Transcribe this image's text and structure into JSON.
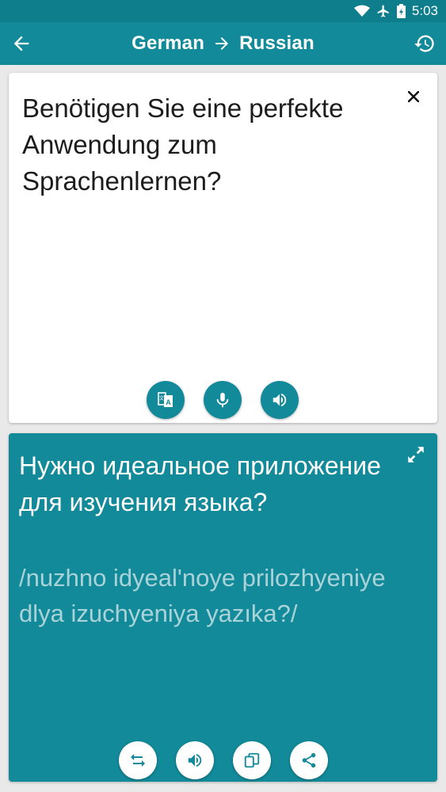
{
  "status_bar": {
    "time": "5:03",
    "icons": [
      "wifi-icon",
      "airplane-icon",
      "battery-charging-icon"
    ]
  },
  "app_bar": {
    "source_language": "German",
    "target_language": "Russian",
    "icons": [
      "back-arrow-icon",
      "arrow-right-icon",
      "history-icon"
    ]
  },
  "source": {
    "text": "Benötigen Sie eine perfekte Anwendung zum Sprachenlernen?",
    "actions": [
      "translate-icon",
      "microphone-icon",
      "speaker-icon"
    ]
  },
  "result": {
    "text": "Нужно идеальное приложение для изучения языка?",
    "transliteration": "/nuzhno idyeal'noye prilozhyeniye dlya izuchyeniya yazıka?/",
    "actions": [
      "swap-icon",
      "speaker-icon",
      "copy-icon",
      "share-icon"
    ]
  },
  "colors": {
    "primary": "#128a99",
    "status_bar": "#0e7d8c",
    "background": "#e9e9e9",
    "transliteration": "#a9d3d8"
  }
}
